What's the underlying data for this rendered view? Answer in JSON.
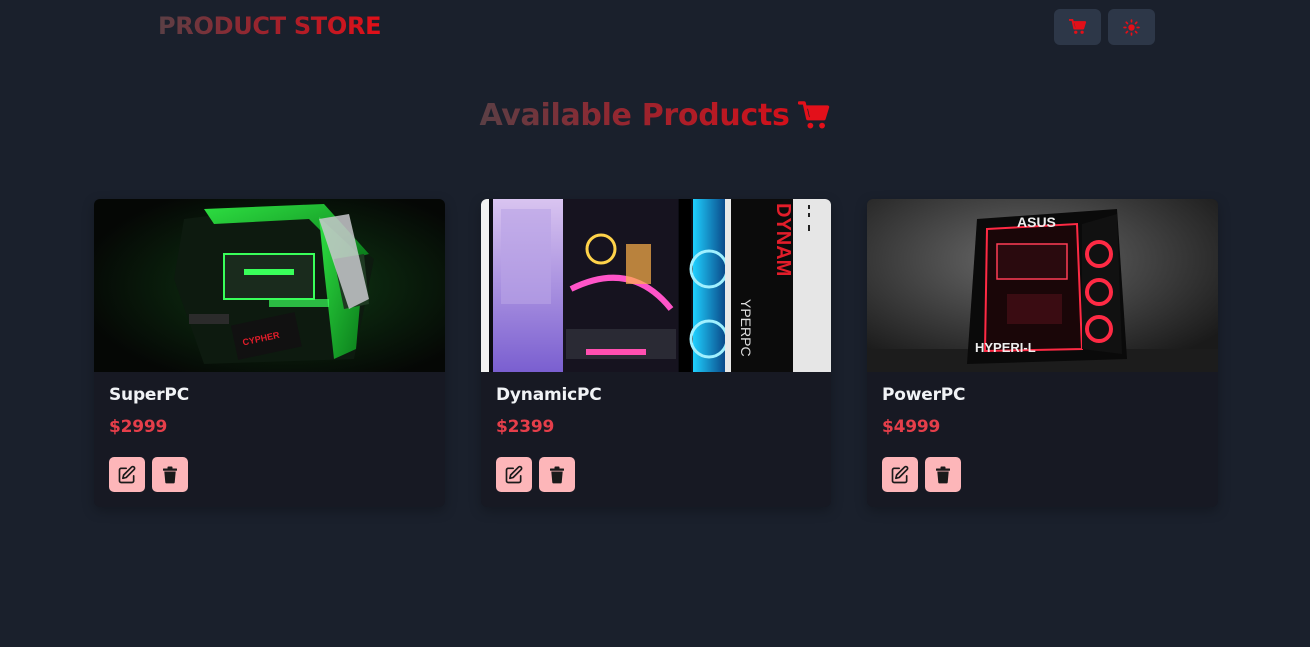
{
  "navbar": {
    "brand": "PRODUCT STORE",
    "cart_icon": "cart-icon",
    "theme_icon": "sun-icon"
  },
  "page": {
    "heading": "Available Products",
    "heading_icon": "cart-icon"
  },
  "products": [
    {
      "name": "SuperPC",
      "price": "$2999",
      "image": "green gaming pc case"
    },
    {
      "name": "DynamicPC",
      "price": "$2399",
      "image": "rgb pc interior"
    },
    {
      "name": "PowerPC",
      "price": "$4999",
      "image": "red lit pc tower"
    }
  ],
  "actions": {
    "edit_icon": "edit-icon",
    "delete_icon": "trash-icon"
  },
  "colors": {
    "background": "#1a202c",
    "card": "#171923",
    "accent_red": "#e30f18",
    "price_red": "#e53e4a",
    "action_button": "#fdb6b9",
    "nav_button": "#2d3748"
  }
}
